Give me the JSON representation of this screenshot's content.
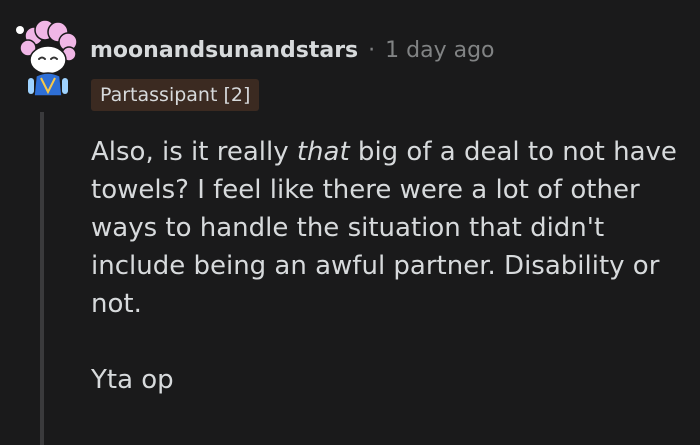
{
  "comment": {
    "username": "moonandsunandstars",
    "separator": "·",
    "timestamp": "1 day ago",
    "flair": "Partassipant [2]",
    "paragraph1": {
      "before": "Also, is it really ",
      "emphasis": "that",
      "after": " big of a deal to not have towels? I feel like there were a lot of other ways to handle the situation that didn't include being an awful partner. Disability or not."
    },
    "paragraph2": "Yta op"
  },
  "colors": {
    "background": "#1a1a1b",
    "text": "#d7dadc",
    "meta": "#818384",
    "flair_bg": "#3b2a21",
    "thread_line": "#3a3a3c"
  },
  "icons": {
    "avatar": "snoo-avatar-pink-hair"
  }
}
